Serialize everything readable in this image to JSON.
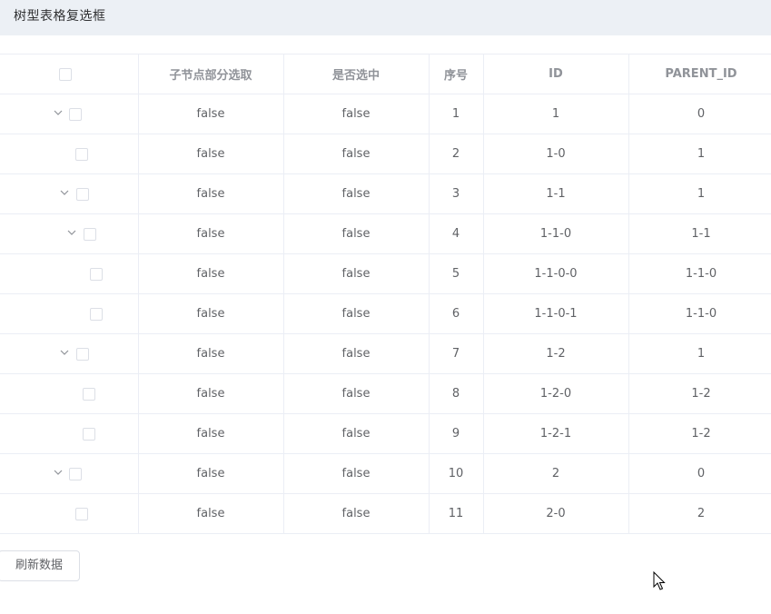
{
  "title": "树型表格复选框",
  "columns": [
    "",
    "子节点部分选取",
    "是否选中",
    "序号",
    "ID",
    "PARENT_ID"
  ],
  "rows": [
    {
      "partial": "false",
      "checked": "false",
      "index": "1",
      "id": "1",
      "parent_id": "0",
      "has_children": true
    },
    {
      "partial": "false",
      "checked": "false",
      "index": "2",
      "id": "1-0",
      "parent_id": "1",
      "has_children": false
    },
    {
      "partial": "false",
      "checked": "false",
      "index": "3",
      "id": "1-1",
      "parent_id": "1",
      "has_children": true
    },
    {
      "partial": "false",
      "checked": "false",
      "index": "4",
      "id": "1-1-0",
      "parent_id": "1-1",
      "has_children": true
    },
    {
      "partial": "false",
      "checked": "false",
      "index": "5",
      "id": "1-1-0-0",
      "parent_id": "1-1-0",
      "has_children": false
    },
    {
      "partial": "false",
      "checked": "false",
      "index": "6",
      "id": "1-1-0-1",
      "parent_id": "1-1-0",
      "has_children": false
    },
    {
      "partial": "false",
      "checked": "false",
      "index": "7",
      "id": "1-2",
      "parent_id": "1",
      "has_children": true
    },
    {
      "partial": "false",
      "checked": "false",
      "index": "8",
      "id": "1-2-0",
      "parent_id": "1-2",
      "has_children": false
    },
    {
      "partial": "false",
      "checked": "false",
      "index": "9",
      "id": "1-2-1",
      "parent_id": "1-2",
      "has_children": false
    },
    {
      "partial": "false",
      "checked": "false",
      "index": "10",
      "id": "2",
      "parent_id": "0",
      "has_children": true
    },
    {
      "partial": "false",
      "checked": "false",
      "index": "11",
      "id": "2-0",
      "parent_id": "2",
      "has_children": false
    }
  ],
  "refresh_button": "刷新数据",
  "colors": {
    "title_bar_bg": "#ecf0f5",
    "border": "#ebeef5",
    "header_text": "#909399",
    "cell_text": "#606266"
  }
}
